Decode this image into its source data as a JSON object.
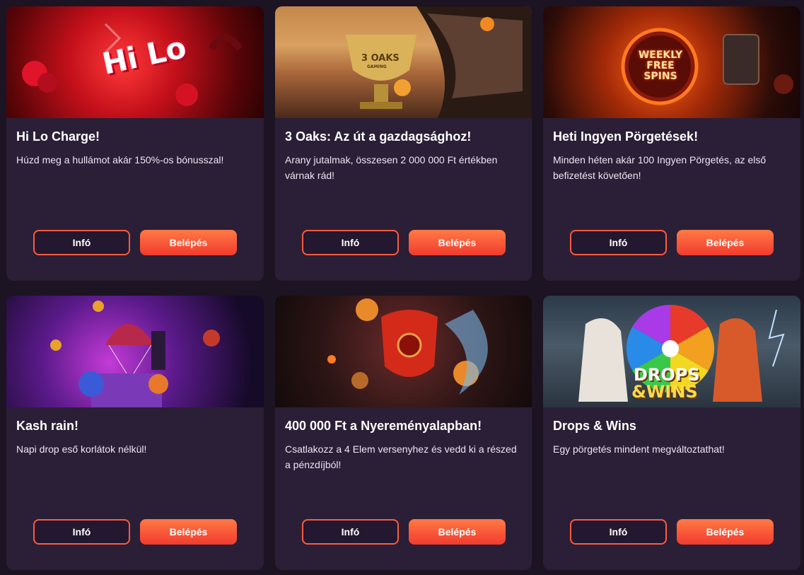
{
  "colors": {
    "page_bg": "#1c1323",
    "card_bg": "#2a1f36",
    "accent": "#ff5a3c",
    "button_gradient_top": "#ff7a45",
    "button_gradient_bottom": "#f23b2e"
  },
  "cards": [
    {
      "image_text": "Hi Lo",
      "title": "Hi Lo Charge!",
      "description": "Húzd meg a hullámot akár 150%-os bónusszal!",
      "info_label": "Infó",
      "login_label": "Belépés"
    },
    {
      "image_text": "3 OAKS",
      "image_subtext": "GAMING",
      "title": "3 Oaks: Az út a gazdagsághoz!",
      "description": "Arany jutalmak, összesen 2 000 000 Ft értékben várnak rád!",
      "info_label": "Infó",
      "login_label": "Belépés"
    },
    {
      "image_text": "WEEKLY FREE SPINS",
      "title": "Heti Ingyen Pörgetések!",
      "description": "Minden héten akár 100 Ingyen Pörgetés, az első befizetést követően!",
      "info_label": "Infó",
      "login_label": "Belépés"
    },
    {
      "title": "Kash rain!",
      "description": "Napi drop eső korlátok nélkül!",
      "info_label": "Infó",
      "login_label": "Belépés"
    },
    {
      "title": "400 000 Ft a Nyereményalapban!",
      "description": "Csatlakozz a 4 Elem versenyhez és vedd ki a részed a pénzdíjból!",
      "info_label": "Infó",
      "login_label": "Belépés"
    },
    {
      "image_text": "DROPS",
      "image_subtext": "&WINS",
      "title": "Drops & Wins",
      "description": "Egy pörgetés mindent megváltoztathat!",
      "info_label": "Infó",
      "login_label": "Belépés"
    }
  ]
}
